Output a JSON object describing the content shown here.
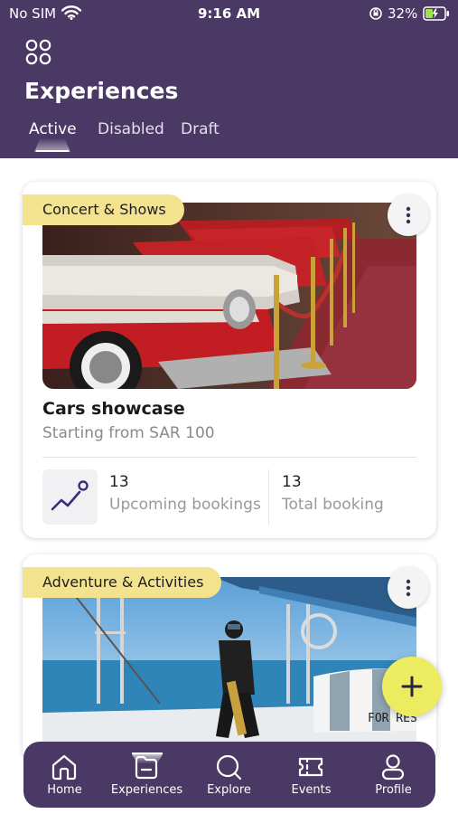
{
  "status_bar": {
    "carrier": "No SIM",
    "time": "9:16 AM",
    "battery_percent": "32%"
  },
  "header": {
    "menu_icon": "grid-icon",
    "title": "Experiences",
    "tabs": [
      {
        "label": "Active",
        "active": true
      },
      {
        "label": "Disabled",
        "active": false
      },
      {
        "label": "Draft",
        "active": false
      }
    ]
  },
  "cards": [
    {
      "category": "Concert & Shows",
      "title": "Cars showcase",
      "subtitle": "Starting from SAR 100",
      "stats": {
        "upcoming_count": "13",
        "upcoming_label": "Upcoming bookings",
        "total_count": "13",
        "total_label": "Total booking"
      }
    },
    {
      "category": "Adventure & Activities"
    }
  ],
  "fab": {
    "icon": "plus-icon"
  },
  "bottom_nav": [
    {
      "label": "Home",
      "icon": "home-icon",
      "active": false
    },
    {
      "label": "Experiences",
      "icon": "experiences-icon",
      "active": true
    },
    {
      "label": "Explore",
      "icon": "search-icon",
      "active": false
    },
    {
      "label": "Events",
      "icon": "ticket-icon",
      "active": false
    },
    {
      "label": "Profile",
      "icon": "profile-icon",
      "active": false
    }
  ],
  "colors": {
    "brand_purple": "#4a3865",
    "badge_yellow": "#f3e28e",
    "fab_yellow": "#edeb5f",
    "stats_icon": "#3b2d7a"
  }
}
